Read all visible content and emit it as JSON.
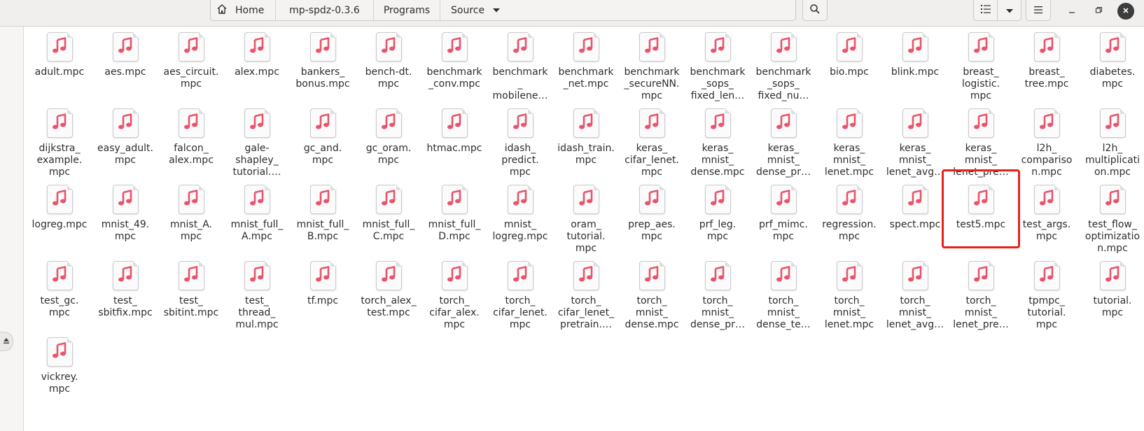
{
  "pathbar": {
    "crumbs": [
      "Home",
      "mp-spdz-0.3.6",
      "Programs",
      "Source"
    ]
  },
  "icons": {
    "home": "home-icon",
    "dropdown": "chevron-down-icon",
    "search": "search-icon",
    "list_view": "list-view-icon",
    "view_options": "chevron-down-icon",
    "menu": "hamburger-menu-icon",
    "minimize": "minimize-icon",
    "maximize": "restore-icon",
    "close": "close-icon",
    "eject": "eject-icon",
    "file": "music-note-icon"
  },
  "colors": {
    "file_note": "#e8546b",
    "highlight_box": "#e8211b"
  },
  "files": [
    "adult.mpc",
    "aes.mpc",
    "aes_circuit.\nmpc",
    "alex.mpc",
    "bankers_\nbonus.mpc",
    "bench-dt.\nmpc",
    "benchmark\n_conv.mpc",
    "benchmark\n_\nmobilene…",
    "benchmark\n_net.mpc",
    "benchmark\n_secureNN.\nmpc",
    "benchmark\n_sops_\nfixed_len…",
    "benchmark\n_sops_\nfixed_nu…",
    "bio.mpc",
    "blink.mpc",
    "breast_\nlogistic.\nmpc",
    "breast_\ntree.mpc",
    "diabetes.\nmpc",
    "dijkstra_\nexample.\nmpc",
    "easy_adult.\nmpc",
    "falcon_\nalex.mpc",
    "gale-\nshapley_\ntutorial.…",
    "gc_and.\nmpc",
    "gc_oram.\nmpc",
    "htmac.mpc",
    "idash_\npredict.\nmpc",
    "idash_train.\nmpc",
    "keras_\ncifar_lenet.\nmpc",
    "keras_\nmnist_\ndense.mpc",
    "keras_\nmnist_\ndense_pr…",
    "keras_\nmnist_\nlenet.mpc",
    "keras_\nmnist_\nlenet_avg…",
    "keras_\nmnist_\nlenet_pre…",
    "l2h_\ncompariso\nn.mpc",
    "l2h_\nmultiplicati\non.mpc",
    "logreg.mpc",
    "mnist_49.\nmpc",
    "mnist_A.\nmpc",
    "mnist_full_\nA.mpc",
    "mnist_full_\nB.mpc",
    "mnist_full_\nC.mpc",
    "mnist_full_\nD.mpc",
    "mnist_\nlogreg.mpc",
    "oram_\ntutorial.\nmpc",
    "prep_aes.\nmpc",
    "prf_leg.\nmpc",
    "prf_mimc.\nmpc",
    "regression.\nmpc",
    "spect.mpc",
    "test5.mpc",
    "test_args.\nmpc",
    "test_flow_\noptimizatio\nn.mpc",
    "test_gc.\nmpc",
    "test_\nsbitfix.mpc",
    "test_\nsbitint.mpc",
    "test_\nthread_\nmul.mpc",
    "tf.mpc",
    "torch_alex_\ntest.mpc",
    "torch_\ncifar_alex.\nmpc",
    "torch_\ncifar_lenet.\nmpc",
    "torch_\ncifar_lenet_\npretrain.…",
    "torch_\nmnist_\ndense.mpc",
    "torch_\nmnist_\ndense_pr…",
    "torch_\nmnist_\ndense_te…",
    "torch_\nmnist_\nlenet.mpc",
    "torch_\nmnist_\nlenet_avg…",
    "torch_\nmnist_\nlenet_pre…",
    "tpmpc_\ntutorial.\nmpc",
    "tutorial.\nmpc",
    "vickrey.\nmpc"
  ],
  "highlighted_file": "test5.mpc"
}
